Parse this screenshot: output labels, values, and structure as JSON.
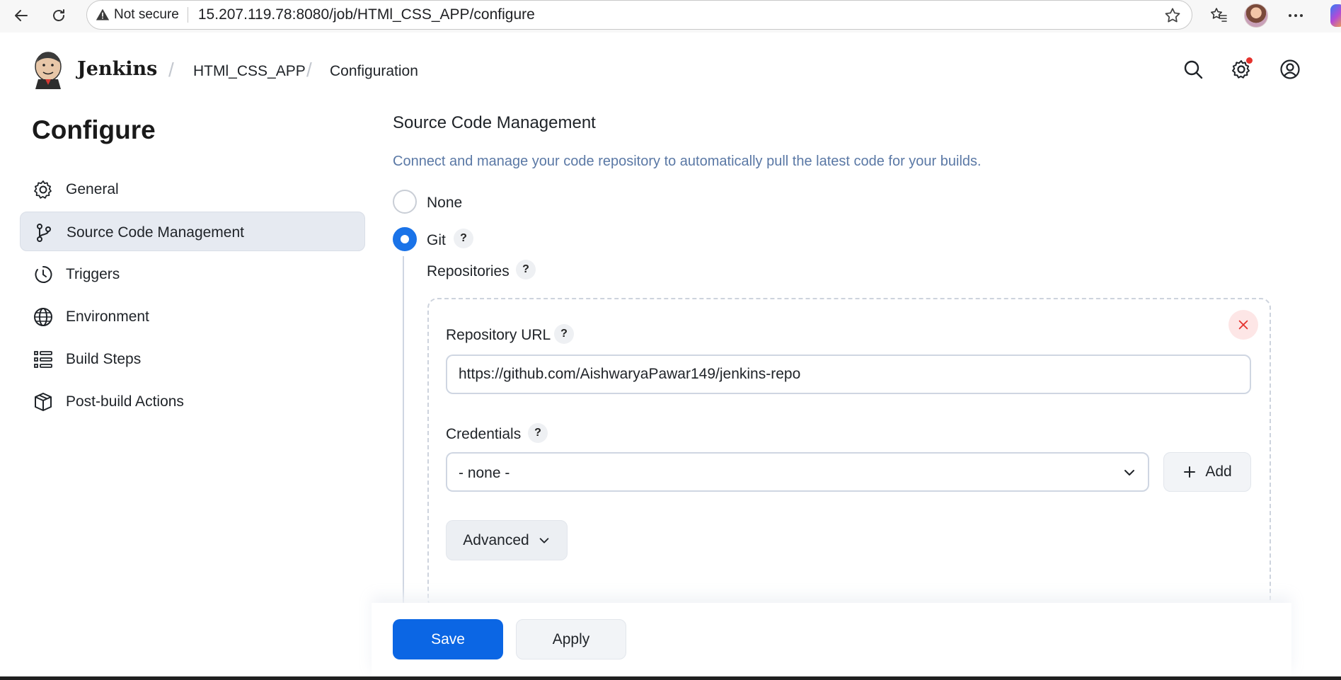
{
  "browser": {
    "security_label": "Not secure",
    "url": "15.207.119.78:8080/job/HTMl_CSS_APP/configure"
  },
  "header": {
    "brand": "Jenkins",
    "breadcrumbs": [
      {
        "label": "HTMl_CSS_APP"
      },
      {
        "label": "Configuration"
      }
    ],
    "separator": "/"
  },
  "sidebar": {
    "title": "Configure",
    "items": [
      {
        "label": "General",
        "icon": "gear-icon"
      },
      {
        "label": "Source Code Management",
        "icon": "git-branch-icon",
        "active": true
      },
      {
        "label": "Triggers",
        "icon": "clock-icon"
      },
      {
        "label": "Environment",
        "icon": "globe-icon"
      },
      {
        "label": "Build Steps",
        "icon": "list-icon"
      },
      {
        "label": "Post-build Actions",
        "icon": "package-icon"
      }
    ]
  },
  "scm": {
    "title": "Source Code Management",
    "description": "Connect and manage your code repository to automatically pull the latest code for your builds.",
    "options": [
      {
        "label": "None",
        "selected": false
      },
      {
        "label": "Git",
        "selected": true
      }
    ],
    "help_glyph": "?",
    "repositories_label": "Repositories",
    "repo_url_label": "Repository URL",
    "repo_url_value": "https://github.com/AishwaryaPawar149/jenkins-repo",
    "credentials_label": "Credentials",
    "credentials_value": "- none -",
    "add_label": "Add",
    "advanced_label": "Advanced"
  },
  "actions": {
    "save_label": "Save",
    "apply_label": "Apply"
  },
  "colors": {
    "primary": "#0b66e4",
    "radio_selected": "#1a73e8",
    "description_text": "#5a78a5",
    "active_nav_bg": "#e6eaf1",
    "close_bg": "#fde6e6",
    "close_x": "#e5322d"
  }
}
